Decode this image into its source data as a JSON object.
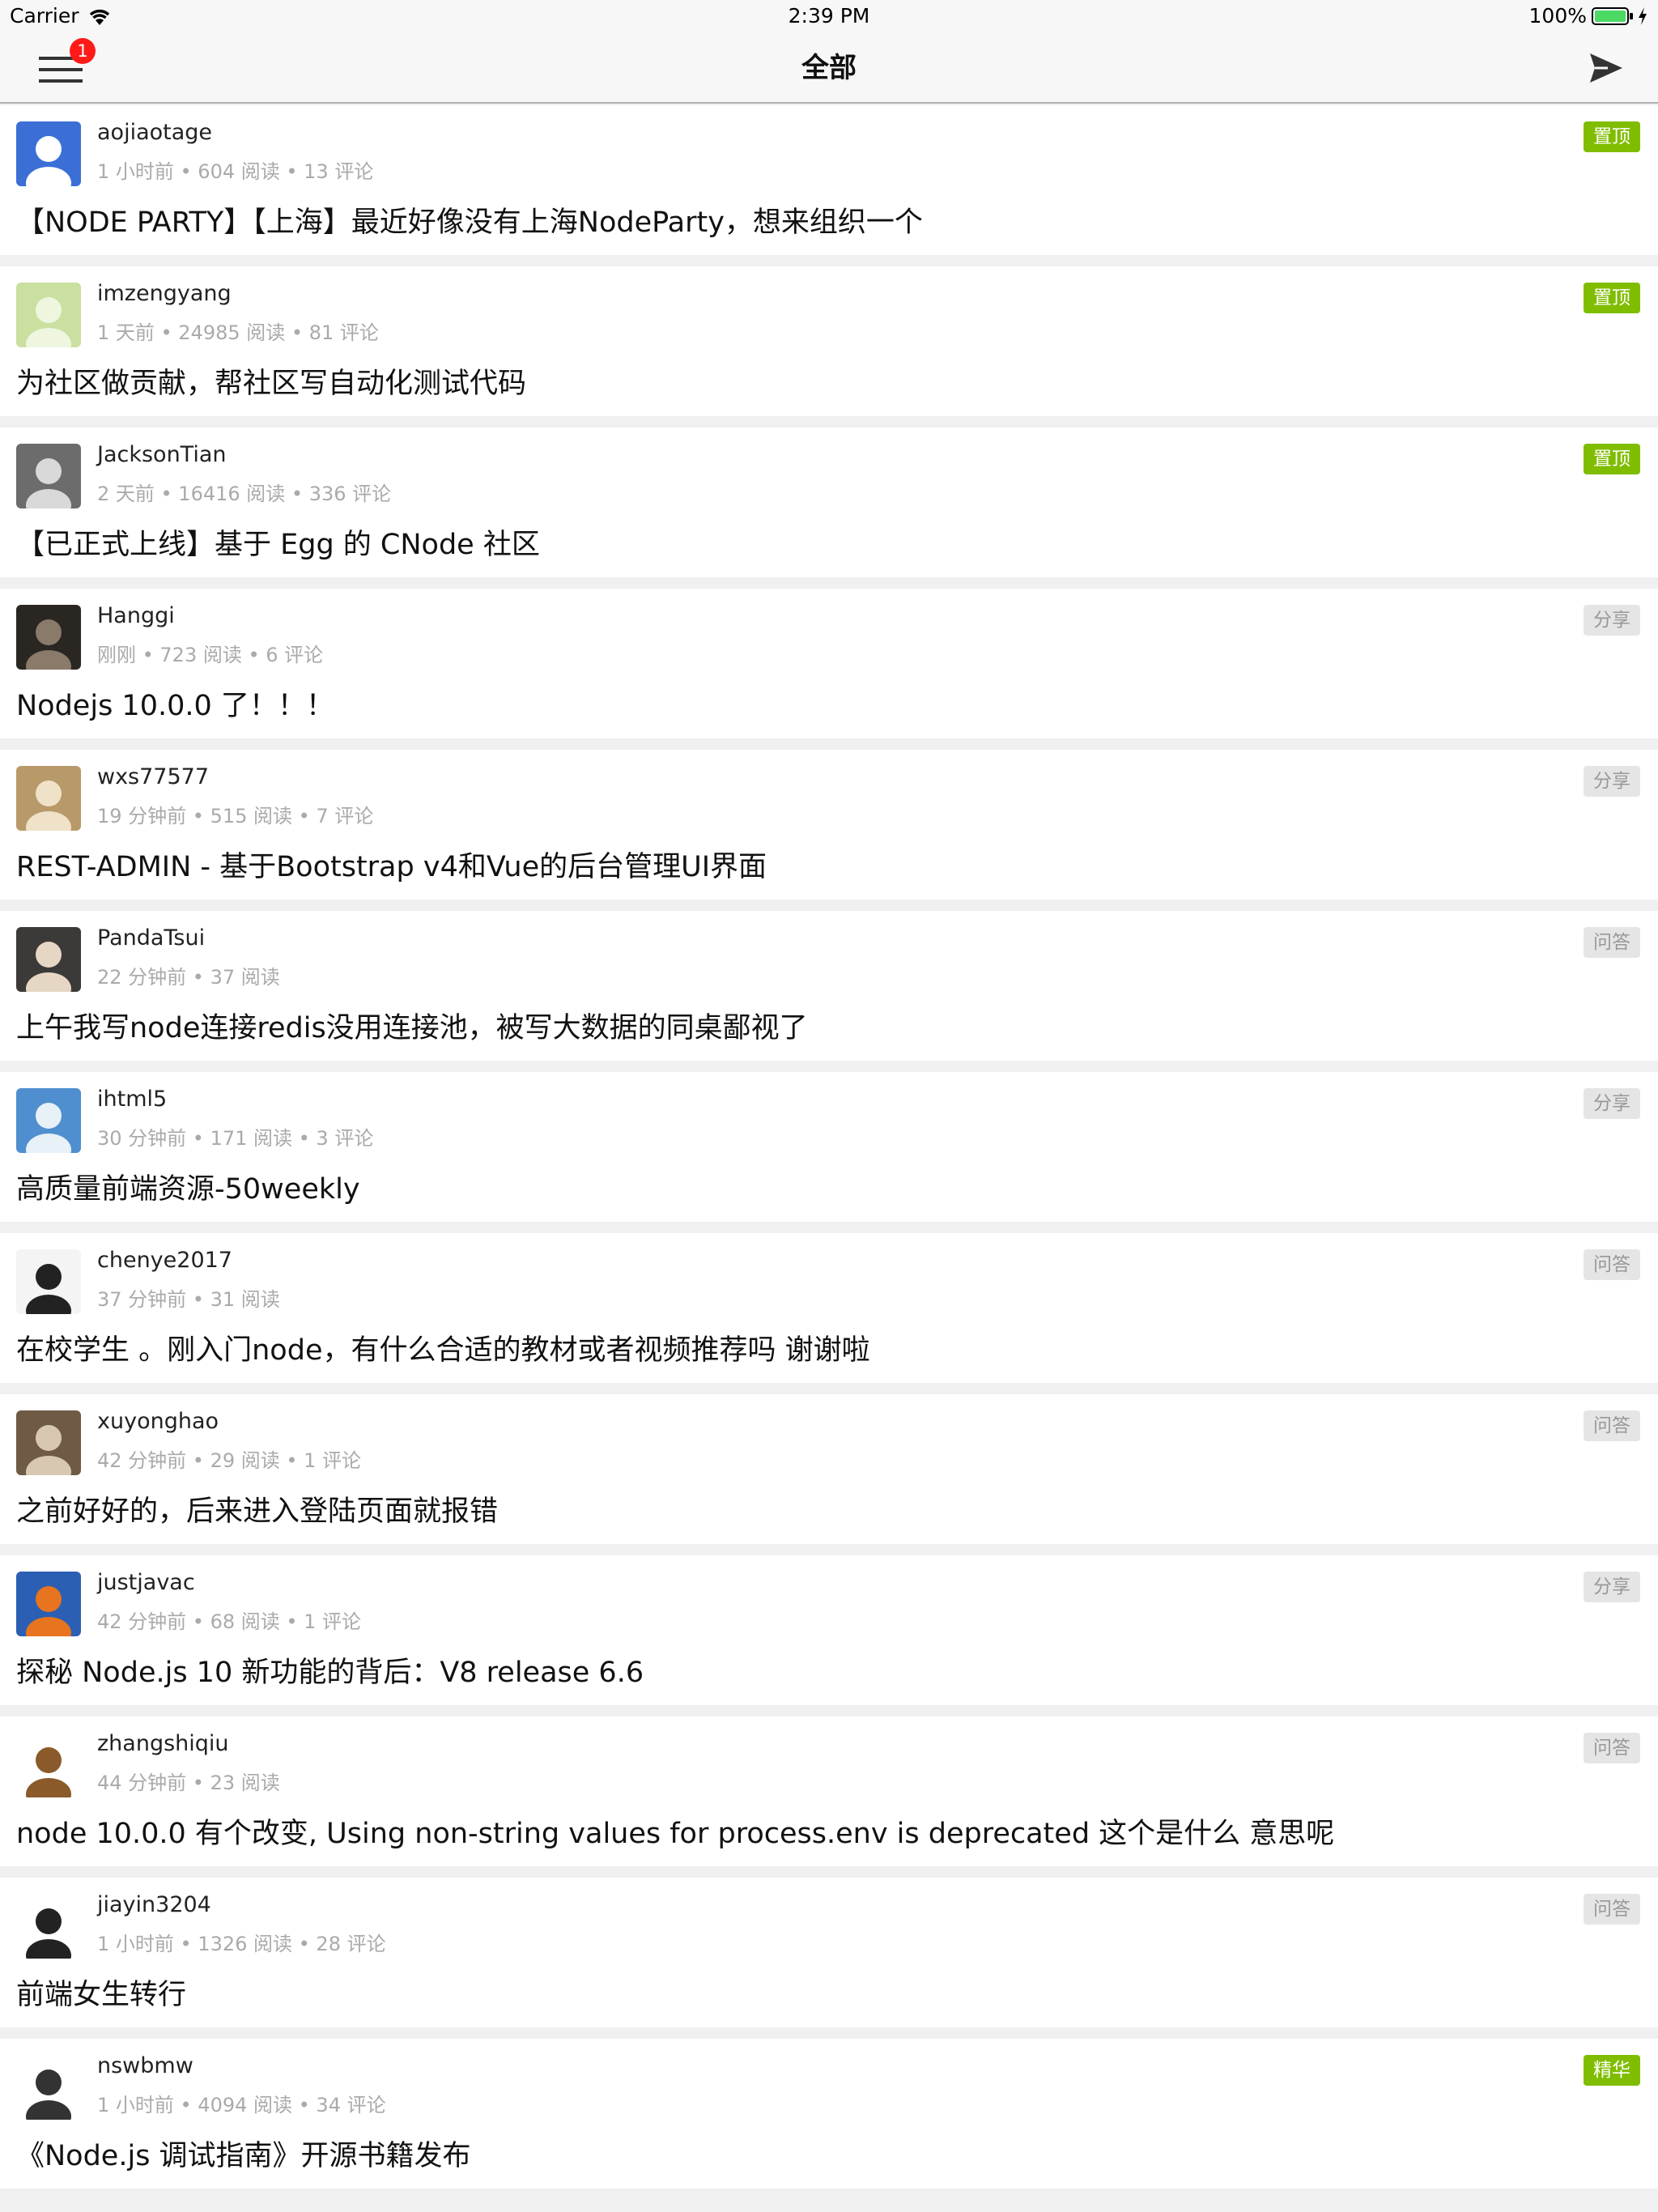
{
  "status_bar": {
    "carrier": "Carrier",
    "time": "2:39 PM",
    "battery": "100%"
  },
  "nav": {
    "title": "全部",
    "badge_count": "1",
    "menu_icon": "hamburger-menu-icon",
    "send_icon": "send-icon"
  },
  "colors": {
    "top_badge": "#80bd01",
    "normal_badge_bg": "#e5e5e5",
    "normal_badge_text": "#999999",
    "notification_badge": "#ff1a1a"
  },
  "topics": [
    {
      "author": "aojiaotage",
      "meta": "1 小时前 • 604 阅读 • 13 评论",
      "title": "【NODE PARTY】【上海】最近好像没有上海NodeParty，想来组织一个",
      "tab": "置顶",
      "tab_style": "top",
      "avatar_bg": "#3b6fd6",
      "avatar_fg": "#ffffff"
    },
    {
      "author": "imzengyang",
      "meta": "1 天前 • 24985 阅读 • 81 评论",
      "title": "为社区做贡献，帮社区写自动化测试代码",
      "tab": "置顶",
      "tab_style": "top",
      "avatar_bg": "#c9e0a0",
      "avatar_fg": "#eef6e0"
    },
    {
      "author": "JacksonTian",
      "meta": "2 天前 • 16416 阅读 • 336 评论",
      "title": "【已正式上线】基于 Egg 的 CNode 社区",
      "tab": "置顶",
      "tab_style": "top",
      "avatar_bg": "#6c6c6c",
      "avatar_fg": "#d9d9d9"
    },
    {
      "author": "Hanggi",
      "meta": "刚刚 • 723 阅读 • 6 评论",
      "title": "Nodejs 10.0.0 了！！！",
      "tab": "分享",
      "tab_style": "normal",
      "avatar_bg": "#2a2622",
      "avatar_fg": "#8a7a6a"
    },
    {
      "author": "wxs77577",
      "meta": "19 分钟前 • 515 阅读 • 7 评论",
      "title": "REST-ADMIN - 基于Bootstrap v4和Vue的后台管理UI界面",
      "tab": "分享",
      "tab_style": "normal",
      "avatar_bg": "#b89a6a",
      "avatar_fg": "#efe2c8"
    },
    {
      "author": "PandaTsui",
      "meta": "22 分钟前 • 37 阅读",
      "title": "上午我写node连接redis没用连接池，被写大数据的同桌鄙视了",
      "tab": "问答",
      "tab_style": "normal",
      "avatar_bg": "#3c3a38",
      "avatar_fg": "#e6d6c4"
    },
    {
      "author": "ihtml5",
      "meta": "30 分钟前 • 171 阅读 • 3 评论",
      "title": "高质量前端资源-50weekly",
      "tab": "分享",
      "tab_style": "normal",
      "avatar_bg": "#4f8fcf",
      "avatar_fg": "#e8f0f8"
    },
    {
      "author": "chenye2017",
      "meta": "37 分钟前 • 31 阅读",
      "title": "在校学生 。刚入门node，有什么合适的教材或者视频推荐吗 谢谢啦",
      "tab": "问答",
      "tab_style": "normal",
      "avatar_bg": "#f4f4f4",
      "avatar_fg": "#222222"
    },
    {
      "author": "xuyonghao",
      "meta": "42 分钟前 • 29 阅读 • 1 评论",
      "title": "之前好好的，后来进入登陆页面就报错",
      "tab": "问答",
      "tab_style": "normal",
      "avatar_bg": "#6f5a45",
      "avatar_fg": "#d8c8b2"
    },
    {
      "author": "justjavac",
      "meta": "42 分钟前 • 68 阅读 • 1 评论",
      "title": "探秘 Node.js 10 新功能的背后：V8 release 6.6",
      "tab": "分享",
      "tab_style": "normal",
      "avatar_bg": "#2b5fb3",
      "avatar_fg": "#e8741f"
    },
    {
      "author": "zhangshiqiu",
      "meta": "44 分钟前 • 23 阅读",
      "title": "node 10.0.0 有个改变, Using non-string values for process.env is deprecated  这个是什么 意思呢",
      "tab": "问答",
      "tab_style": "normal",
      "avatar_bg": "#ffffff",
      "avatar_fg": "#8a5a2a"
    },
    {
      "author": "jiayin3204",
      "meta": "1 小时前 • 1326 阅读 • 28 评论",
      "title": "前端女生转行",
      "tab": "问答",
      "tab_style": "normal",
      "avatar_bg": "#ffffff",
      "avatar_fg": "#222222"
    },
    {
      "author": "nswbmw",
      "meta": "1 小时前 • 4094 阅读 • 34 评论",
      "title": "《Node.js 调试指南》开源书籍发布",
      "tab": "精华",
      "tab_style": "top",
      "avatar_bg": "#ffffff",
      "avatar_fg": "#333333"
    }
  ]
}
